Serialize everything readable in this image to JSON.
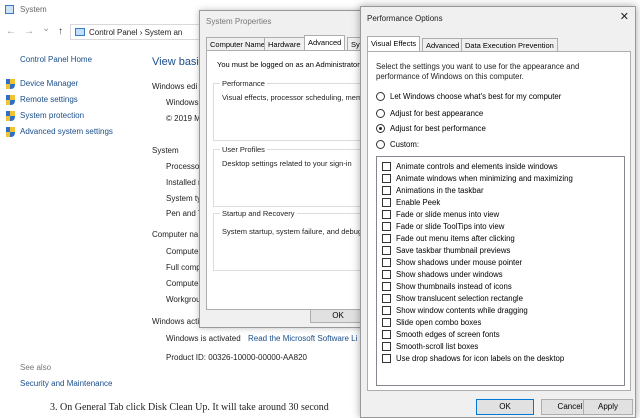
{
  "system_window": {
    "title": "System",
    "nav": {
      "back": "←",
      "forward": "→",
      "down": "⌄",
      "up": "↑"
    },
    "address": "Control Panel  ›  System an",
    "sidebar": {
      "home": "Control Panel Home",
      "items": [
        {
          "label": "Device Manager"
        },
        {
          "label": "Remote settings"
        },
        {
          "label": "System protection"
        },
        {
          "label": "Advanced system settings"
        }
      ],
      "see_also": "See also",
      "security_maintenance": "Security and Maintenance"
    },
    "main": {
      "view_basic": "View basic",
      "windows_edition": "Windows edi",
      "windows": "Windows",
      "copyright": "© 2019 M",
      "system": "System",
      "processor": "Processo",
      "installed": "Installed r",
      "system_type": "System ty",
      "pen": "Pen and T",
      "computer_name": "Computer na",
      "comp1": "Compute",
      "fullcomp": "Full comp",
      "comp2": "Compute",
      "workgroup": "Workgrou",
      "activation": "Windows acti",
      "activated": "Windows is activated",
      "license_link": "Read the Microsoft Software Li",
      "product_id": "Product ID:  00326-10000-00000-AA820"
    },
    "footer_text": "3. On General Tab click Disk Clean Up. It will take around 30 second"
  },
  "system_properties": {
    "title": "System Properties",
    "tabs": [
      "Computer Name",
      "Hardware",
      "Advanced",
      "Sys"
    ],
    "admin_note": "You must be logged on as an Administrator to",
    "groups": [
      {
        "title": "Performance",
        "desc": "Visual effects, processor scheduling, memo"
      },
      {
        "title": "User Profiles",
        "desc": "Desktop settings related to your sign-in"
      },
      {
        "title": "Startup and Recovery",
        "desc": "System startup, system failure, and debuggi"
      }
    ],
    "ok": "OK"
  },
  "performance_options": {
    "title": "Performance Options",
    "close": "✕",
    "tabs": [
      "Visual Effects",
      "Advanced",
      "Data Execution Prevention"
    ],
    "intro_line1": "Select the settings you want to use for the appearance and",
    "intro_line2": "performance of Windows on this computer.",
    "radios": [
      {
        "label": "Let Windows choose what's best for my computer",
        "checked": false
      },
      {
        "label": "Adjust for best appearance",
        "checked": false
      },
      {
        "label": "Adjust for best performance",
        "checked": true
      },
      {
        "label": "Custom:",
        "checked": false
      }
    ],
    "checkboxes": [
      "Animate controls and elements inside windows",
      "Animate windows when minimizing and maximizing",
      "Animations in the taskbar",
      "Enable Peek",
      "Fade or slide menus into view",
      "Fade or slide ToolTips into view",
      "Fade out menu items after clicking",
      "Save taskbar thumbnail previews",
      "Show shadows under mouse pointer",
      "Show shadows under windows",
      "Show thumbnails instead of icons",
      "Show translucent selection rectangle",
      "Show window contents while dragging",
      "Slide open combo boxes",
      "Smooth edges of screen fonts",
      "Smooth-scroll list boxes",
      "Use drop shadows for icon labels on the desktop"
    ],
    "buttons": {
      "ok": "OK",
      "cancel": "Cancel",
      "apply": "Apply"
    }
  }
}
